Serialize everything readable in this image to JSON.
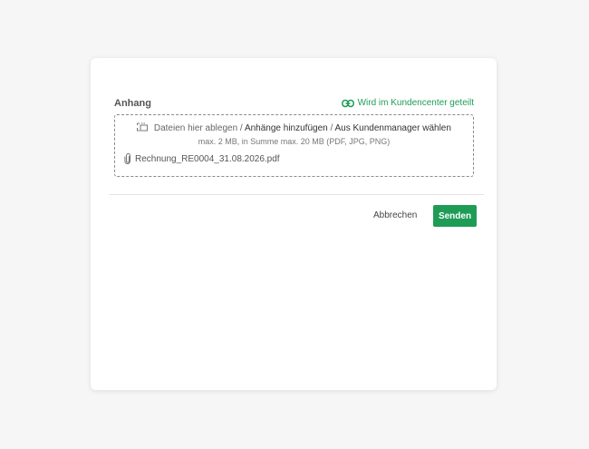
{
  "attachment": {
    "title": "Anhang",
    "share_link": "Wird im Kundencenter geteilt",
    "share_icon": "link-icon",
    "dropzone": {
      "upload_icon": "upload-icon",
      "drop_text": "Dateien hier ablegen /",
      "add_link": "Anhänge hinzufügen",
      "separator": "/",
      "manager_link": "Aus Kundenmanager wählen",
      "limits": "max. 2 MB, in Summe max. 20 MB (PDF, JPG, PNG)"
    },
    "files": [
      {
        "icon": "paperclip-icon",
        "name": "Rechnung_RE0004_31.08.2026.pdf"
      }
    ]
  },
  "actions": {
    "cancel_label": "Abbrechen",
    "send_label": "Senden"
  },
  "colors": {
    "accent": "#1e9c56",
    "background": "#f6f6f6",
    "modal": "#ffffff"
  }
}
